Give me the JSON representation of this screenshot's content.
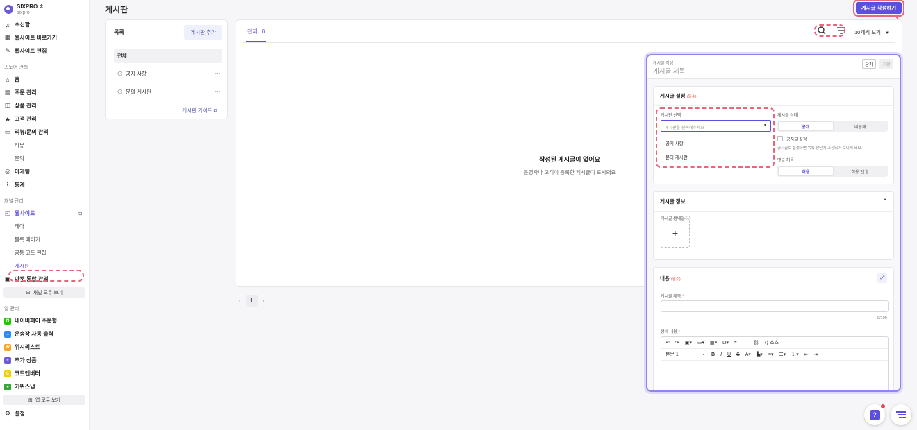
{
  "brand": {
    "name": "SIXPRO",
    "sub": "sixpro"
  },
  "nav_top": [
    {
      "icon": "bell-icon",
      "glyph": "♫",
      "label": "수신함"
    },
    {
      "icon": "grid-icon",
      "glyph": "▦",
      "label": "웹사이트 바로가기"
    },
    {
      "icon": "pencil-icon",
      "glyph": "✎",
      "label": "웹사이트 편집"
    }
  ],
  "store_section": "스토어 관리",
  "store_items": [
    {
      "icon": "home-icon",
      "glyph": "⌂",
      "label": "홈",
      "sub": false
    },
    {
      "icon": "order-icon",
      "glyph": "▤",
      "label": "주문 관리",
      "sub": false
    },
    {
      "icon": "product-icon",
      "glyph": "◫",
      "label": "상품 관리",
      "sub": false
    },
    {
      "icon": "customer-icon",
      "glyph": "♣",
      "label": "고객 관리",
      "sub": false
    },
    {
      "icon": "review-icon",
      "glyph": "▭",
      "label": "리뷰/문의 관리",
      "sub": false
    },
    {
      "icon": "",
      "glyph": "",
      "label": "리뷰",
      "sub": true
    },
    {
      "icon": "",
      "glyph": "",
      "label": "문의",
      "sub": true
    },
    {
      "icon": "marketing-icon",
      "glyph": "◎",
      "label": "마케팅",
      "sub": false
    },
    {
      "icon": "stats-icon",
      "glyph": "⌇",
      "label": "통계",
      "sub": false
    }
  ],
  "channel_section": "채널 관리",
  "channel_items": [
    {
      "icon": "website-icon",
      "glyph": "◰",
      "label": "웹사이트",
      "sub": false,
      "active": true
    },
    {
      "icon": "",
      "glyph": "",
      "label": "테마",
      "sub": true
    },
    {
      "icon": "",
      "glyph": "",
      "label": "블록 메이커",
      "sub": true
    },
    {
      "icon": "",
      "glyph": "",
      "label": "공통 코드 편집",
      "sub": true
    },
    {
      "icon": "",
      "glyph": "",
      "label": "게시판",
      "sub": true,
      "active": true
    },
    {
      "icon": "market-icon",
      "glyph": "▣",
      "label": "마켓 통합 관리",
      "sub": false
    }
  ],
  "channel_viewall": "채널 모두 보기",
  "app_section": "앱 관리",
  "apps": [
    {
      "icon": "naverpay-icon",
      "color": "#1ec800",
      "glyph": "N",
      "label": "네이버페이 주문형"
    },
    {
      "icon": "invoice-icon",
      "color": "#2d8cf0",
      "glyph": "→",
      "label": "운송장 자동 출력"
    },
    {
      "icon": "wishlist-icon",
      "color": "#f5a623",
      "glyph": "W",
      "label": "위시리스트"
    },
    {
      "icon": "addproduct-icon",
      "color": "#6a5cd8",
      "glyph": "+",
      "label": "추가 상품"
    },
    {
      "icon": "code-icon",
      "color": "#f0d000",
      "glyph": "C",
      "label": "코드엔버터"
    },
    {
      "icon": "kiwi-icon",
      "color": "#3aa53a",
      "glyph": "●",
      "label": "키위스냅"
    }
  ],
  "app_viewall": "앱 모두 보기",
  "settings": "설정",
  "page_title": "게시판",
  "write_button": "게시글 작성하기",
  "board_list": {
    "title": "목록",
    "add": "게시판 추가",
    "items": [
      {
        "label": "전체",
        "selected": true
      },
      {
        "label": "공지 사항",
        "selected": false
      },
      {
        "label": "문의 게시판",
        "selected": false
      }
    ],
    "guide": "게시판 가이드"
  },
  "main": {
    "tab": "전체",
    "count": "0",
    "page_size": "10개씩 보기",
    "empty_title": "작성된 게시글이 없어요",
    "empty_sub": "운영자나 고객이 등록한 게시글이 표시돼요",
    "page": "1"
  },
  "modal": {
    "sub": "게시글 작성",
    "title": "게시글 제목",
    "close": "닫기",
    "save": "저장",
    "settings": {
      "title": "게시글 설정",
      "req": "(필수)",
      "board_label": "게시판 선택",
      "board_placeholder": "게시판을 선택해주세요",
      "options": [
        "공지 사항",
        "문의 게시판"
      ],
      "status_label": "게시글 상태",
      "status": [
        "공개",
        "비공개"
      ],
      "notice_label": "공지글 설정",
      "notice_desc": "공지글로 설정하면 목록 상단에 고정되어 보이게 돼요.",
      "comment_label": "댓글 허용",
      "comment": [
        "허용",
        "허용 안 함"
      ]
    },
    "info": {
      "title": "게시글 정보",
      "thumb_label": "게시글 썸네일"
    },
    "content": {
      "title": "내용",
      "req": "(필수)",
      "post_title_label": "게시글 제목",
      "counter": "0/100",
      "body_label": "상세 내용",
      "source": "소스",
      "paragraph": "본문 1"
    }
  },
  "colors": {
    "accent": "#5b4ee0",
    "highlight": "#e8667c"
  }
}
